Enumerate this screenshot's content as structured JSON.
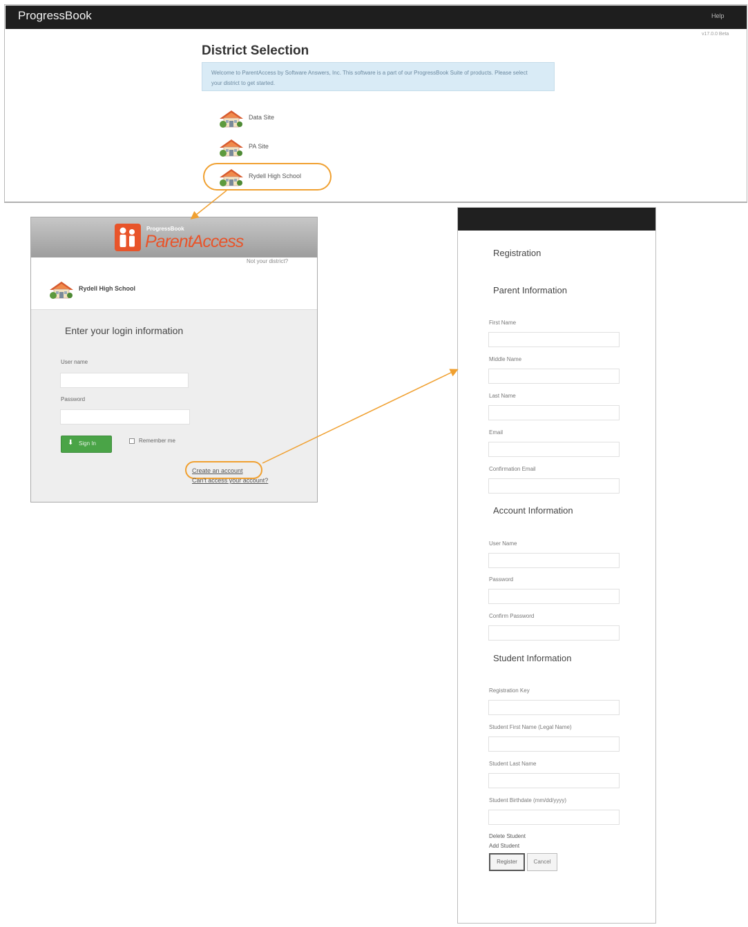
{
  "colors": {
    "topbar": "#1e1e1e",
    "welcome_bg": "#d9ebf6",
    "highlight": "#f0a030",
    "brand_orange": "#e8542a",
    "signin_green": "#4aa447"
  },
  "header": {
    "brand": "ProgressBook",
    "help": "Help",
    "version": "v17.0.0 Beta"
  },
  "district_selection": {
    "title": "District Selection",
    "welcome": "Welcome to ParentAccess by Software Answers, Inc. This software is a part of our ProgressBook Suite of products. Please select your district to get started.",
    "districts": [
      {
        "name": "Data Site",
        "icon": "school-house-icon"
      },
      {
        "name": "PA Site",
        "icon": "school-house-icon"
      },
      {
        "name": "Rydell High School",
        "icon": "school-house-icon"
      }
    ]
  },
  "login": {
    "logo_small": "ProgressBook",
    "logo_name": "ParentAccess",
    "not_district": "Not your district?",
    "school": "Rydell High School",
    "heading": "Enter your login information",
    "username_label": "User name",
    "password_label": "Password",
    "signin_label": "Sign In",
    "signin_icon": "download-arrow-icon",
    "remember_label": "Remember me",
    "create_account": "Create an account",
    "cant_access": "Can't access your account?"
  },
  "registration": {
    "title": "Registration",
    "parent_section": "Parent Information",
    "parent_fields": [
      "First Name",
      "Middle Name",
      "Last Name",
      "Email",
      "Confirmation Email"
    ],
    "account_section": "Account Information",
    "account_fields": [
      "User Name",
      "Password",
      "Confirm Password"
    ],
    "student_section": "Student Information",
    "student_fields": [
      "Registration Key",
      "Student First Name (Legal Name)",
      "Student Last Name",
      "Student Birthdate (mm/dd/yyyy)"
    ],
    "delete_student": "Delete Student",
    "add_student": "Add Student",
    "register": "Register",
    "cancel": "Cancel"
  }
}
